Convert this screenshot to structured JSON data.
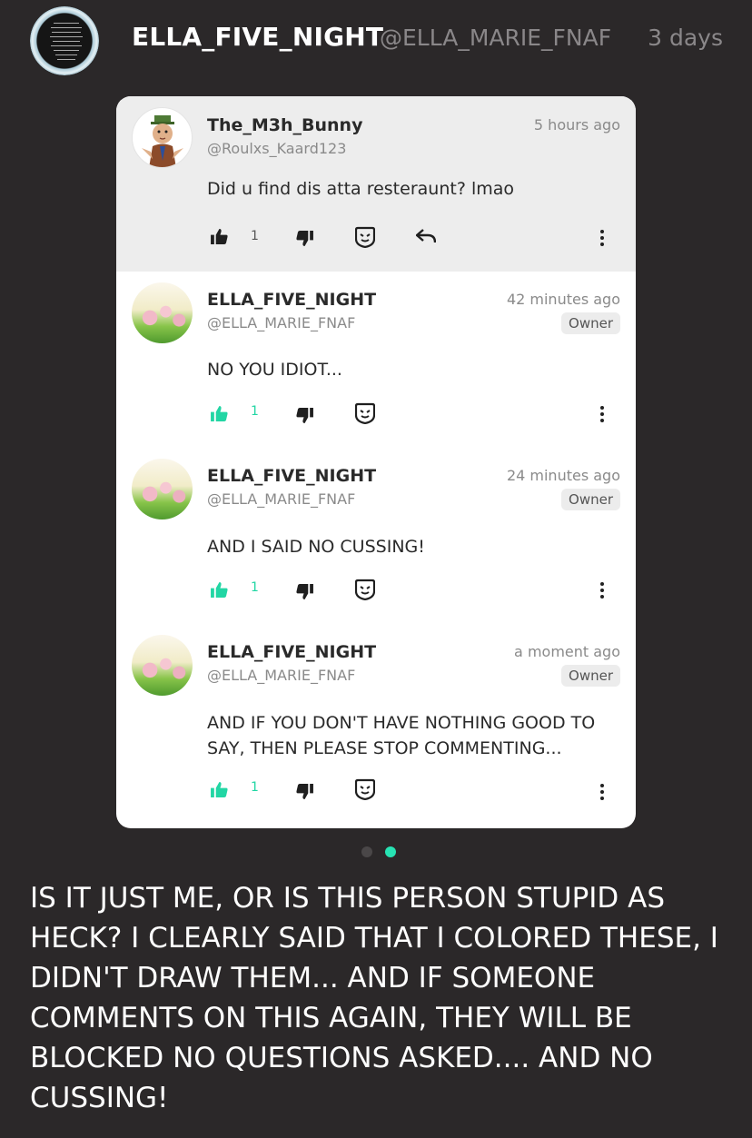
{
  "post": {
    "author_name": "ELLA_FIVE_NIGHT",
    "author_handle": "@ELLA_MARIE_FNAF",
    "time": "3 days",
    "caption": "IS IT JUST ME, OR IS THIS PERSON STUPID AS HECK? I CLEARLY SAID THAT I COLORED THESE, I DIDN'T DRAW THEM... AND IF SOMEONE COMMENTS ON THIS AGAIN, THEY WILL BE BLOCKED NO QUESTIONS ASKED.... AND NO CUSSING!"
  },
  "comments": [
    {
      "name": "The_M3h_Bunny",
      "handle": "@Roulxs_Kaard123",
      "time": "5 hours ago",
      "text": "Did u find dis atta resteraunt? lmao",
      "likes": "1",
      "liked": false,
      "badge": ""
    },
    {
      "name": "ELLA_FIVE_NIGHT",
      "handle": "@ELLA_MARIE_FNAF",
      "time": "42 minutes ago",
      "badge": "Owner",
      "text": "NO YOU IDIOT...",
      "likes": "1",
      "liked": true
    },
    {
      "name": "ELLA_FIVE_NIGHT",
      "handle": "@ELLA_MARIE_FNAF",
      "time": "24 minutes ago",
      "badge": "Owner",
      "text": "AND I SAID NO CUSSING!",
      "likes": "1",
      "liked": true
    },
    {
      "name": "ELLA_FIVE_NIGHT",
      "handle": "@ELLA_MARIE_FNAF",
      "time": "a moment ago",
      "badge": "Owner",
      "text": "AND IF YOU DON'T HAVE NOTHING GOOD TO SAY, THEN PLEASE STOP COMMENTING...",
      "likes": "1",
      "liked": true
    }
  ],
  "pagination": {
    "total": 2,
    "current": 2
  },
  "colors": {
    "background": "#2b2829",
    "accent": "#27e3b3",
    "like_active": "#22d6a4",
    "muted_text": "#8a8789"
  },
  "icons": {
    "like": "thumbs-up-icon",
    "dislike": "thumbs-down-icon",
    "award": "shield-face-icon",
    "reply": "reply-arrow-icon",
    "more": "more-vertical-icon"
  }
}
